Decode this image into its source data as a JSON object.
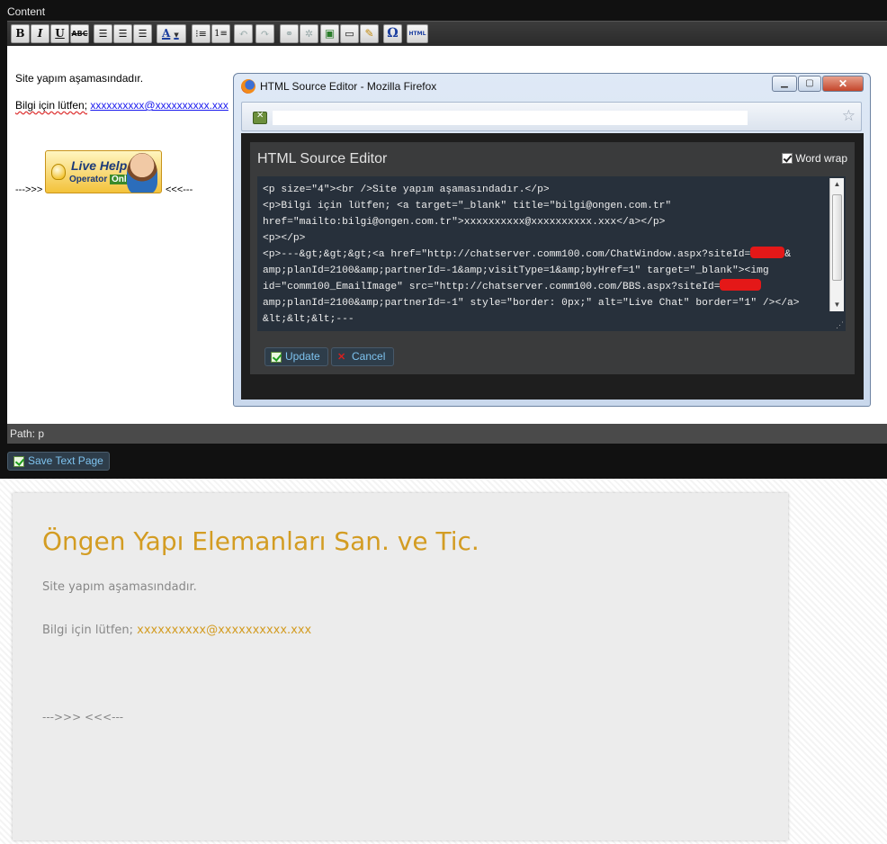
{
  "editor": {
    "content_label": "Content",
    "toolbar": {
      "bold": "B",
      "italic": "I",
      "underline": "U",
      "strike": "ABC",
      "font_color": "A",
      "special_char": "Ω",
      "html": "HTML",
      "icons": [
        "bold-icon",
        "italic-icon",
        "underline-icon",
        "strikethrough-icon",
        "align-left-icon",
        "align-center-icon",
        "align-right-icon",
        "font-color-icon",
        "bullet-list-icon",
        "numbered-list-icon",
        "undo-icon",
        "redo-icon",
        "link-icon",
        "unlink-icon",
        "image-icon",
        "horizontal-rule-icon",
        "clean-format-icon",
        "special-char-icon",
        "html-icon"
      ]
    },
    "body": {
      "line1": "Site yapım aşamasındadır.",
      "line2_prefix": "Bilgi için lütfen;",
      "line2_link": "xxxxxxxxxx@xxxxxxxxxx.xxx",
      "arrow_left": "--->>>",
      "arrow_right": "<<<---"
    },
    "livehelp": {
      "title": "Live Help",
      "subtitle_a": "Operator",
      "subtitle_b": "Online"
    },
    "path": "Path: p",
    "save_button": "Save Text Page"
  },
  "popup": {
    "window_title": "HTML Source Editor - Mozilla Firefox",
    "heading": "HTML Source Editor",
    "word_wrap_label": "Word wrap",
    "word_wrap_checked": true,
    "code_lines": [
      "<p size=\"4\"><br />Site yapım aşamasındadır.</p>",
      "<p>Bilgi için lütfen; <a target=\"_blank\" title=\"bilgi@ongen.com.tr\"",
      "href=\"mailto:bilgi@ongen.com.tr\">xxxxxxxxxx@xxxxxxxxxx.xxx</a></p>",
      "<p></p>",
      "<p>---&gt;&gt;&gt;<a href=\"http://chatserver.comm100.com/ChatWindow.aspx?siteId=",
      "amp;planId=2100&amp;partnerId=-1&amp;visitType=1&amp;byHref=1\" target=\"_blank\"><img",
      "id=\"comm100_EmailImage\" src=\"http://chatserver.comm100.com/BBS.aspx?siteId=",
      "amp;planId=2100&amp;partnerId=-1\" style=\"border: 0px;\" alt=\"Live Chat\" border=\"1\" /></a>",
      "&lt;&lt;&lt;---"
    ],
    "code_suffix_line5": "&",
    "update_button": "Update",
    "cancel_button": "Cancel"
  },
  "preview": {
    "title": "Öngen Yapı Elemanları San. ve Tic.",
    "line1": "Site yapım aşamasındadır.",
    "line2_prefix": "Bilgi için lütfen;",
    "line2_link": "xxxxxxxxxx@xxxxxxxxxx.xxx",
    "arrows": "--->>> <<<---"
  }
}
